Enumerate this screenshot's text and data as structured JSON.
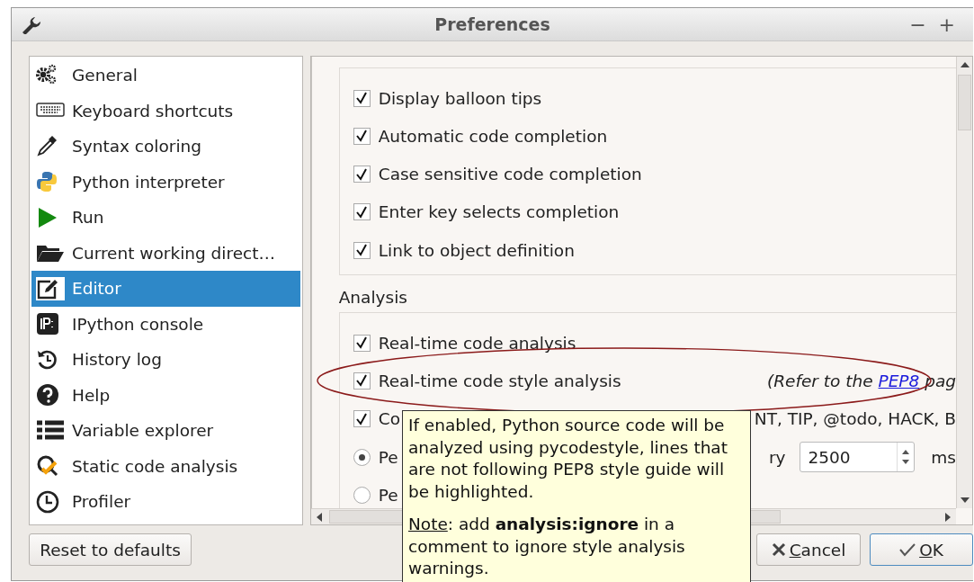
{
  "window": {
    "title": "Preferences",
    "controls": [
      "−",
      "+"
    ]
  },
  "sidebar": {
    "items": [
      {
        "label": "General",
        "selected": false
      },
      {
        "label": "Keyboard shortcuts",
        "selected": false
      },
      {
        "label": "Syntax coloring",
        "selected": false
      },
      {
        "label": "Python interpreter",
        "selected": false
      },
      {
        "label": "Run",
        "selected": false
      },
      {
        "label": "Current working direct…",
        "selected": false
      },
      {
        "label": "Editor",
        "selected": true
      },
      {
        "label": "IPython console",
        "selected": false
      },
      {
        "label": "History log",
        "selected": false
      },
      {
        "label": "Help",
        "selected": false
      },
      {
        "label": "Variable explorer",
        "selected": false
      },
      {
        "label": "Static code analysis",
        "selected": false
      },
      {
        "label": "Profiler",
        "selected": false
      }
    ]
  },
  "groups": [
    {
      "options": [
        {
          "kind": "checkbox",
          "label": "Display balloon tips",
          "checked": true
        },
        {
          "kind": "checkbox",
          "label": "Automatic code completion",
          "checked": true
        },
        {
          "kind": "checkbox",
          "label": "Case sensitive code completion",
          "checked": true
        },
        {
          "kind": "checkbox",
          "label": "Enter key selects completion",
          "checked": true
        },
        {
          "kind": "checkbox",
          "label": "Link to object definition",
          "checked": true
        }
      ]
    },
    {
      "title": "Analysis",
      "options": [
        {
          "kind": "checkbox",
          "label": "Real-time code analysis",
          "checked": true
        },
        {
          "kind": "checkbox",
          "label": "Real-time code style analysis",
          "checked": true,
          "circled": true,
          "note": "(Refer to the ",
          "link": "PEP8",
          "note_end": " pag"
        },
        {
          "kind": "partial-checkbox",
          "label": "Co",
          "checked": true,
          "label_end": "NT, TIP, @todo, HACK, B"
        },
        {
          "kind": "radio",
          "label": "Pe",
          "selected": true,
          "label_end": "ry",
          "spin_value": "2500",
          "unit": "ms"
        },
        {
          "kind": "radio",
          "label": "Pe",
          "selected": false
        }
      ]
    }
  ],
  "tooltip": {
    "text": "If enabled, Python source code will be analyzed using pycodestyle, lines that are not following PEP8 style guide will be highlighted.",
    "note_label": "Note",
    "note_text": ": add **analysis:ignore** in a comment to ignore style analysis warnings."
  },
  "buttons": [
    {
      "kind": "reset",
      "label": "Reset to defaults"
    },
    {
      "kind": "cancel",
      "label": "Cancel",
      "mnemonic": true
    },
    {
      "kind": "ok",
      "label": "OK",
      "mnemonic": true
    }
  ]
}
